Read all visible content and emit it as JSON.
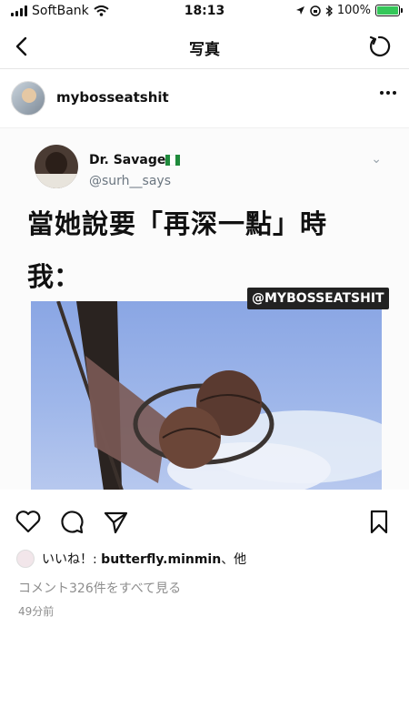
{
  "status_bar": {
    "carrier": "SoftBank",
    "time": "18:13",
    "battery": "100%",
    "battery_level": 1.0
  },
  "nav": {
    "title": "写真"
  },
  "post": {
    "username": "mybosseatshit",
    "image": {
      "tweet_name": "Dr. Savage",
      "tweet_handle": "@surh__says",
      "tweet_text_line1": "當她說要「再深一點」時",
      "tweet_text_line2": "我：",
      "watermark": "@MYBOSSEATSHIT"
    },
    "likes_prefix": "いいね！: ",
    "likes_user": "butterfly.minmin",
    "likes_suffix": "、他",
    "comments_link": "コメント326件をすべて見る",
    "timestamp": "49分前"
  },
  "colors": {
    "battery_green": "#34c759",
    "secondary_text": "#8e8e8e",
    "flag_green": "#1f8a3c"
  }
}
